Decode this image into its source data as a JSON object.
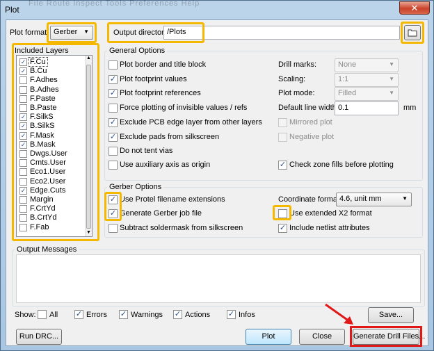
{
  "window": {
    "title": "Plot",
    "menu_ghost": "File  Route  Inspect  Tools  Preferences  Help",
    "close_glyph": "✕"
  },
  "plot_format": {
    "label": "Plot format:",
    "value": "Gerber"
  },
  "output_directory": {
    "label": "Output directory:",
    "value": "/Plots",
    "folder_icon": "folder-icon"
  },
  "layers": {
    "title": "Included Layers",
    "items": [
      {
        "name": "F.Cu",
        "checked": true
      },
      {
        "name": "B.Cu",
        "checked": true
      },
      {
        "name": "F.Adhes",
        "checked": false
      },
      {
        "name": "B.Adhes",
        "checked": false
      },
      {
        "name": "F.Paste",
        "checked": false
      },
      {
        "name": "B.Paste",
        "checked": false
      },
      {
        "name": "F.SilkS",
        "checked": true
      },
      {
        "name": "B.SilkS",
        "checked": true
      },
      {
        "name": "F.Mask",
        "checked": true
      },
      {
        "name": "B.Mask",
        "checked": true
      },
      {
        "name": "Dwgs.User",
        "checked": false
      },
      {
        "name": "Cmts.User",
        "checked": false
      },
      {
        "name": "Eco1.User",
        "checked": false
      },
      {
        "name": "Eco2.User",
        "checked": false
      },
      {
        "name": "Edge.Cuts",
        "checked": true
      },
      {
        "name": "Margin",
        "checked": false
      },
      {
        "name": "F.CrtYd",
        "checked": false
      },
      {
        "name": "B.CrtYd",
        "checked": false
      },
      {
        "name": "F.Fab",
        "checked": false
      }
    ]
  },
  "general_options": {
    "title": "General Options",
    "left": [
      {
        "label": "Plot border and title block",
        "checked": false
      },
      {
        "label": "Plot footprint values",
        "checked": true
      },
      {
        "label": "Plot footprint references",
        "checked": true
      },
      {
        "label": "Force plotting of invisible values / refs",
        "checked": false
      },
      {
        "label": "Exclude PCB edge layer from other layers",
        "checked": true
      },
      {
        "label": "Exclude pads from silkscreen",
        "checked": true
      },
      {
        "label": "Do not tent vias",
        "checked": false
      },
      {
        "label": "Use auxiliary axis as origin",
        "checked": false
      }
    ],
    "drill_marks": {
      "label": "Drill marks:",
      "value": "None"
    },
    "scaling": {
      "label": "Scaling:",
      "value": "1:1"
    },
    "plot_mode": {
      "label": "Plot mode:",
      "value": "Filled"
    },
    "line_width": {
      "label": "Default line width:",
      "value": "0.1",
      "unit": "mm"
    },
    "mirrored": {
      "label": "Mirrored plot",
      "checked": false
    },
    "negative": {
      "label": "Negative plot",
      "checked": false
    },
    "zone_fills": {
      "label": "Check zone fills before plotting",
      "checked": true
    }
  },
  "gerber_options": {
    "title": "Gerber Options",
    "protel": {
      "label": "Use Protel filename extensions",
      "checked": true
    },
    "job_file": {
      "label": "Generate Gerber job file",
      "checked": true
    },
    "subtract": {
      "label": "Subtract soldermask from silkscreen",
      "checked": false
    },
    "coord_format": {
      "label": "Coordinate format:",
      "value": "4.6, unit mm"
    },
    "x2_format": {
      "label": "Use extended X2 format",
      "checked": false
    },
    "netlist": {
      "label": "Include netlist attributes",
      "checked": true
    }
  },
  "output_messages": {
    "title": "Output Messages",
    "show_label": "Show:",
    "filters": [
      {
        "label": "All",
        "checked": false
      },
      {
        "label": "Errors",
        "checked": true
      },
      {
        "label": "Warnings",
        "checked": true
      },
      {
        "label": "Actions",
        "checked": true
      },
      {
        "label": "Infos",
        "checked": true
      }
    ],
    "save_label": "Save..."
  },
  "buttons": {
    "run_drc": "Run DRC...",
    "plot": "Plot",
    "close": "Close",
    "drill": "Generate Drill Files..."
  },
  "highlight_colors": {
    "yellow": "#f5b800",
    "red": "#e01818"
  }
}
